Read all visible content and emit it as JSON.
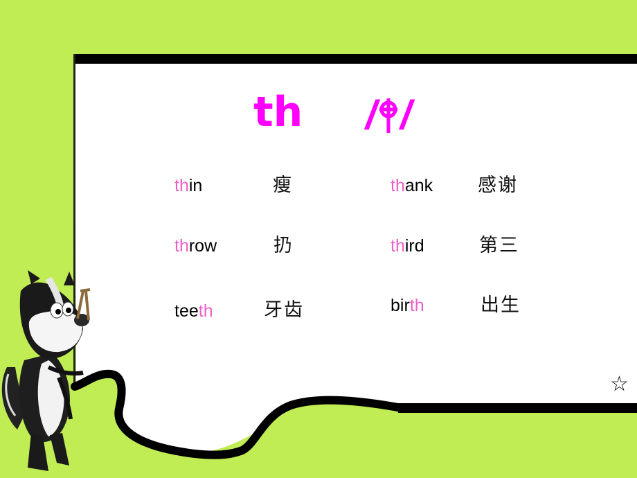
{
  "slide": {
    "background_color": "#c0ec54",
    "panel_color": "#ffffff",
    "border_color": "#000000",
    "accent_color": "#ff00ff",
    "highlight_color": "#ee60c8",
    "title": "th",
    "phonetic": {
      "open": "/",
      "symbol_icon": "theta-icon",
      "close": "/"
    },
    "words": [
      {
        "hl_before": "",
        "prefix": "th",
        "rest": "in",
        "suffix": "",
        "meaning": "瘦"
      },
      {
        "hl_before": "",
        "prefix": "th",
        "rest": "row",
        "suffix": "",
        "meaning": "扔"
      },
      {
        "hl_before": "tee",
        "prefix": "",
        "rest": "",
        "suffix": "th",
        "meaning": "牙齿"
      },
      {
        "hl_before": "",
        "prefix": "th",
        "rest": "ank",
        "suffix": "",
        "meaning": "感谢"
      },
      {
        "hl_before": "",
        "prefix": "th",
        "rest": "ird",
        "suffix": "",
        "meaning": "第三"
      },
      {
        "hl_before": "bir",
        "prefix": "",
        "rest": "",
        "suffix": "th",
        "meaning": "出生"
      }
    ],
    "star_symbol": "☆",
    "mascot": "skunk-with-slingshot"
  }
}
